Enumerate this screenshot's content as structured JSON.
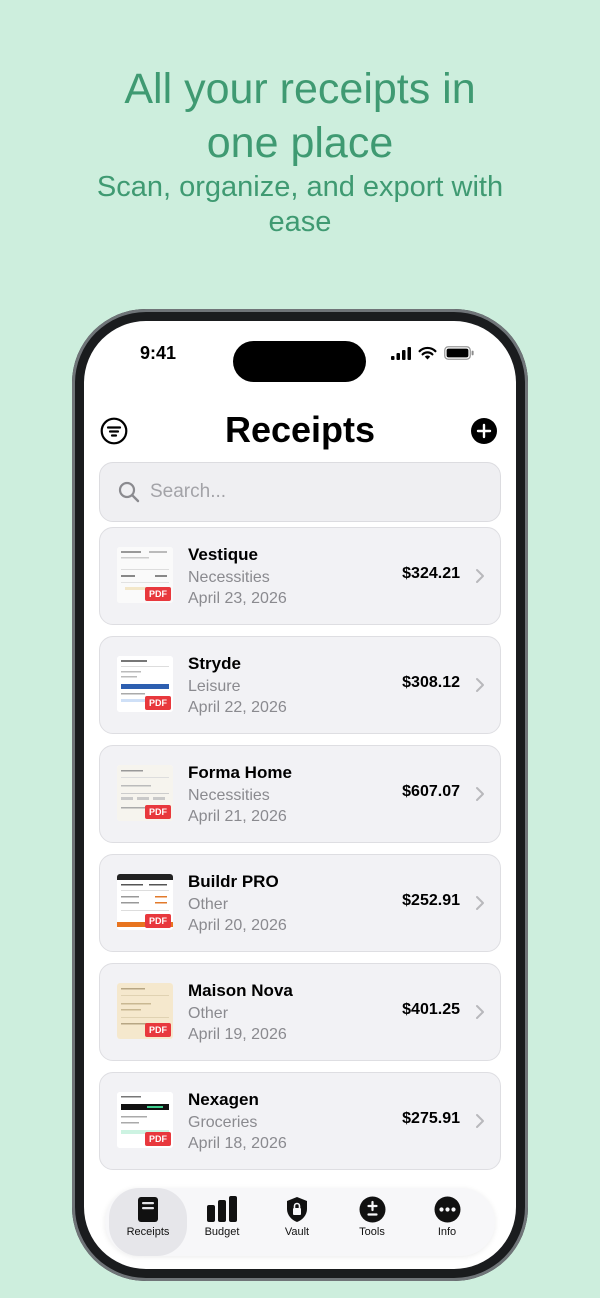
{
  "headline": {
    "title": "All your receipts in one place",
    "subtitle": "Scan, organize, and export with ease"
  },
  "status_bar": {
    "time": "9:41"
  },
  "header": {
    "title": "Receipts"
  },
  "search": {
    "placeholder": "Search..."
  },
  "receipts": [
    {
      "merchant": "Vestique",
      "category": "Necessities",
      "date": "April 23, 2026",
      "amount": "$324.21",
      "badge": "PDF"
    },
    {
      "merchant": "Stryde",
      "category": "Leisure",
      "date": "April 22, 2026",
      "amount": "$308.12",
      "badge": "PDF"
    },
    {
      "merchant": "Forma Home",
      "category": "Necessities",
      "date": "April 21, 2026",
      "amount": "$607.07",
      "badge": "PDF"
    },
    {
      "merchant": "Buildr PRO",
      "category": "Other",
      "date": "April 20, 2026",
      "amount": "$252.91",
      "badge": "PDF"
    },
    {
      "merchant": "Maison Nova",
      "category": "Other",
      "date": "April 19, 2026",
      "amount": "$401.25",
      "badge": "PDF"
    },
    {
      "merchant": "Nexagen",
      "category": "Groceries",
      "date": "April 18, 2026",
      "amount": "$275.91",
      "badge": "PDF"
    }
  ],
  "tabs": [
    {
      "label": "Receipts",
      "icon": "receipt-icon",
      "active": true
    },
    {
      "label": "Budget",
      "icon": "bar-chart-icon",
      "active": false
    },
    {
      "label": "Vault",
      "icon": "lock-shield-icon",
      "active": false
    },
    {
      "label": "Tools",
      "icon": "plus-minus-icon",
      "active": false
    },
    {
      "label": "Info",
      "icon": "more-icon",
      "active": false
    }
  ],
  "colors": {
    "background": "#cdeedd",
    "headline": "#3f9a72",
    "pdf_badge": "#e8383d"
  }
}
